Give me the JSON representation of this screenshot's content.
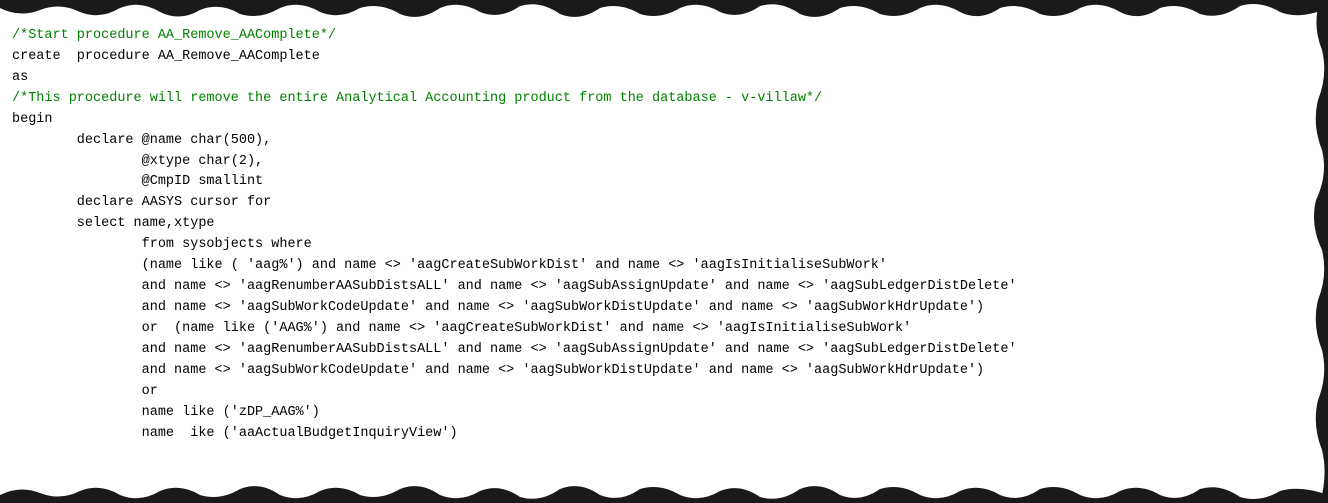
{
  "code": {
    "lines": [
      {
        "text": "/*Start procedure AA_Remove_AAComplete*/",
        "type": "comment"
      },
      {
        "text": "create  procedure AA_Remove_AAComplete",
        "type": "normal"
      },
      {
        "text": "as",
        "type": "normal"
      },
      {
        "text": "/*This procedure will remove the entire Analytical Accounting product from the database - v-villaw*/",
        "type": "comment"
      },
      {
        "text": "begin",
        "type": "normal"
      },
      {
        "text": "        declare @name char(500),",
        "type": "normal"
      },
      {
        "text": "                @xtype char(2),",
        "type": "normal"
      },
      {
        "text": "                @CmpID smallint",
        "type": "normal"
      },
      {
        "text": "",
        "type": "normal"
      },
      {
        "text": "        declare AASYS cursor for",
        "type": "normal"
      },
      {
        "text": "        select name,xtype",
        "type": "normal"
      },
      {
        "text": "                from sysobjects where",
        "type": "normal"
      },
      {
        "text": "                (name like ( 'aag%') and name <> 'aagCreateSubWorkDist' and name <> 'aagIsInitialiseSubWork'",
        "type": "normal"
      },
      {
        "text": "                and name <> 'aagRenumberAASubDistsALL' and name <> 'aagSubAssignUpdate' and name <> 'aagSubLedgerDistDelete'",
        "type": "normal"
      },
      {
        "text": "                and name <> 'aagSubWorkCodeUpdate' and name <> 'aagSubWorkDistUpdate' and name <> 'aagSubWorkHdrUpdate')",
        "type": "normal"
      },
      {
        "text": "                or  (name like ('AAG%') and name <> 'aagCreateSubWorkDist' and name <> 'aagIsInitialiseSubWork'",
        "type": "normal"
      },
      {
        "text": "                and name <> 'aagRenumberAASubDistsALL' and name <> 'aagSubAssignUpdate' and name <> 'aagSubLedgerDistDelete'",
        "type": "normal"
      },
      {
        "text": "                and name <> 'aagSubWorkCodeUpdate' and name <> 'aagSubWorkDistUpdate' and name <> 'aagSubWorkHdrUpdate')",
        "type": "normal"
      },
      {
        "text": "                or",
        "type": "normal"
      },
      {
        "text": "                name like ('zDP_AAG%')",
        "type": "normal"
      },
      {
        "text": "                name  ike ('aaActualBudgetInquiryView')",
        "type": "normal"
      }
    ]
  }
}
